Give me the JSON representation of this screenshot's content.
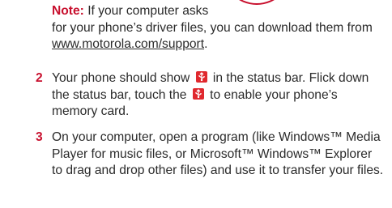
{
  "note": {
    "label": "Note:",
    "line1": " If your computer asks",
    "line2": "for your phone’s driver files, you can download them from ",
    "link": "www.motorola.com/support",
    "end": "."
  },
  "steps": [
    {
      "number": "2",
      "text_a": "Your phone should show ",
      "text_b": " in the status bar. Flick down the status bar, touch the ",
      "text_c": " to enable your phone’s memory card."
    },
    {
      "number": "3",
      "text": "On your computer, open a program (like Windows™ Media Player for music files, or Microsoft™ Windows™ Explorer to drag and drop other files) and use it to transfer your files."
    }
  ],
  "icons": {
    "status_icon": "usb-icon",
    "icon_color": "#e0282e",
    "accent_color": "#c8102e"
  }
}
